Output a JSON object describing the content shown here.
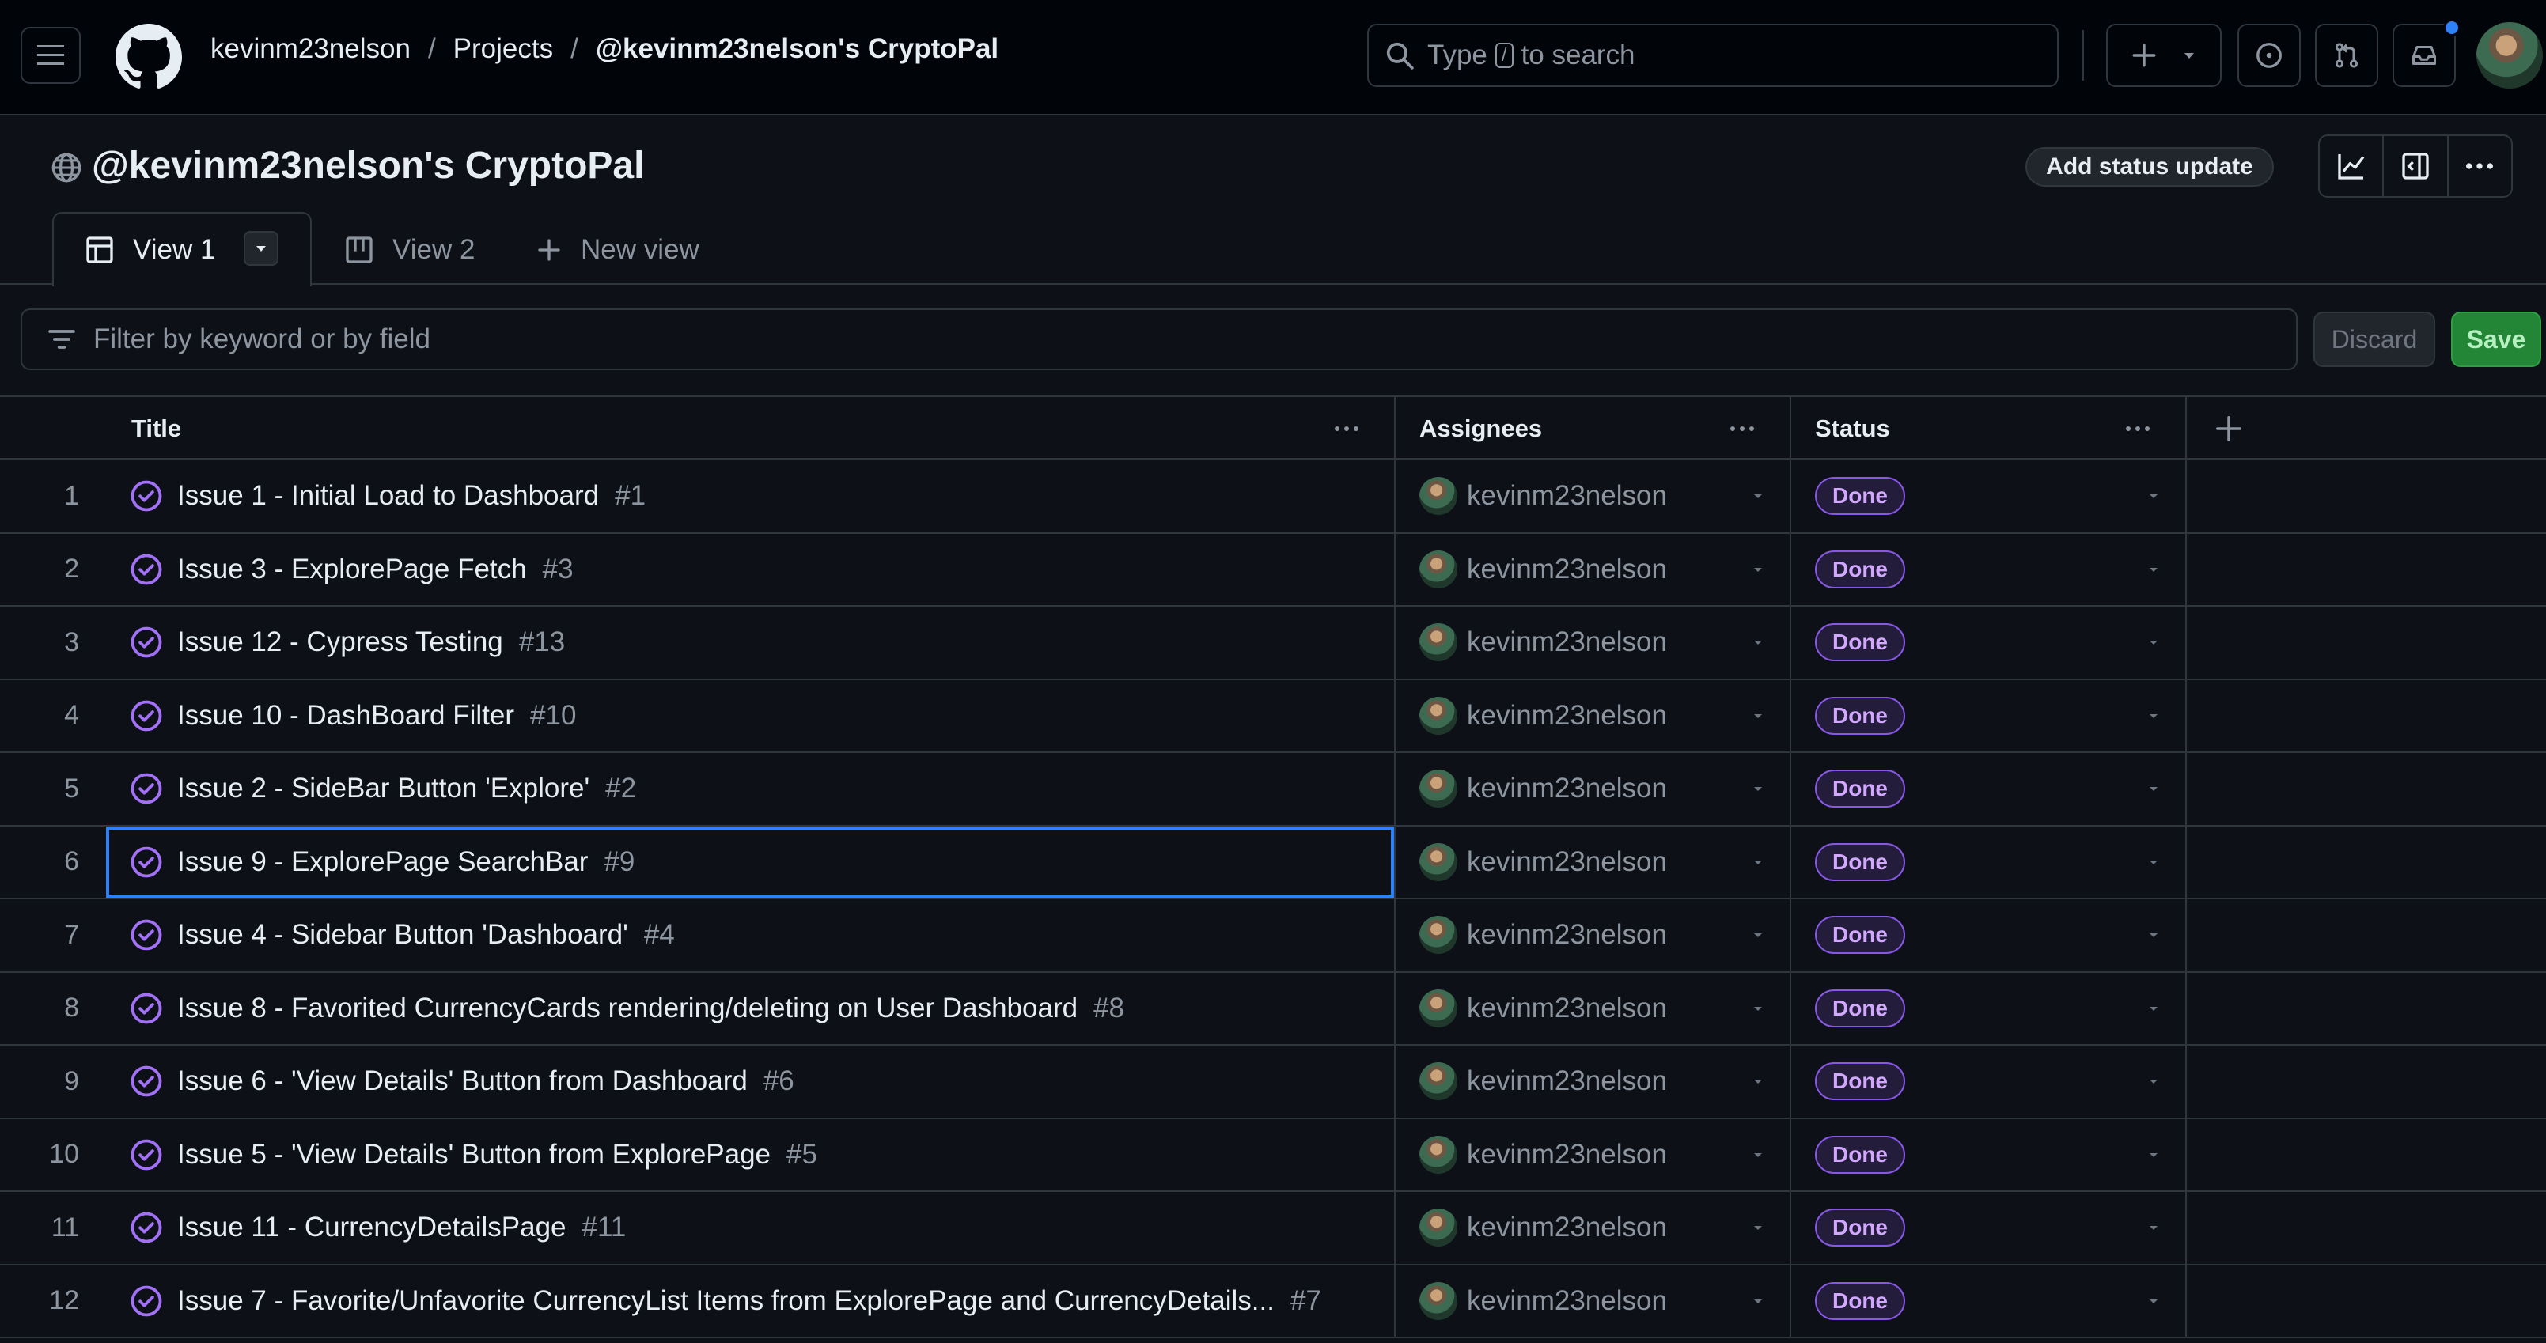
{
  "header": {
    "breadcrumbs": [
      "kevinm23nelson",
      "Projects",
      "@kevinm23nelson's CryptoPal"
    ],
    "separator": "/",
    "search": {
      "prefix": "Type",
      "key": "/",
      "suffix": "to search"
    }
  },
  "project": {
    "title": "@kevinm23nelson's CryptoPal",
    "status_update_label": "Add status update"
  },
  "tabs": [
    {
      "label": "View 1",
      "active": true
    },
    {
      "label": "View 2",
      "active": false
    }
  ],
  "new_view_label": "New view",
  "filter": {
    "placeholder": "Filter by keyword or by field",
    "discard_label": "Discard",
    "save_label": "Save"
  },
  "table": {
    "columns": [
      "Title",
      "Assignees",
      "Status"
    ],
    "rows": [
      {
        "index": "1",
        "title": "Issue 1 - Initial Load to Dashboard",
        "number": "#1",
        "assignee": "kevinm23nelson",
        "status": "Done"
      },
      {
        "index": "2",
        "title": "Issue 3 - ExplorePage Fetch",
        "number": "#3",
        "assignee": "kevinm23nelson",
        "status": "Done"
      },
      {
        "index": "3",
        "title": "Issue 12 - Cypress Testing",
        "number": "#13",
        "assignee": "kevinm23nelson",
        "status": "Done"
      },
      {
        "index": "4",
        "title": "Issue 10 - DashBoard Filter",
        "number": "#10",
        "assignee": "kevinm23nelson",
        "status": "Done"
      },
      {
        "index": "5",
        "title": "Issue 2 - SideBar Button 'Explore'",
        "number": "#2",
        "assignee": "kevinm23nelson",
        "status": "Done"
      },
      {
        "index": "6",
        "title": "Issue 9 - ExplorePage SearchBar",
        "number": "#9",
        "assignee": "kevinm23nelson",
        "status": "Done",
        "selected": true
      },
      {
        "index": "7",
        "title": "Issue 4 - Sidebar Button 'Dashboard'",
        "number": "#4",
        "assignee": "kevinm23nelson",
        "status": "Done"
      },
      {
        "index": "8",
        "title": "Issue 8 - Favorited CurrencyCards rendering/deleting on User Dashboard",
        "number": "#8",
        "assignee": "kevinm23nelson",
        "status": "Done"
      },
      {
        "index": "9",
        "title": "Issue 6 - 'View Details' Button from Dashboard",
        "number": "#6",
        "assignee": "kevinm23nelson",
        "status": "Done"
      },
      {
        "index": "10",
        "title": "Issue 5 - 'View Details' Button from ExplorePage",
        "number": "#5",
        "assignee": "kevinm23nelson",
        "status": "Done"
      },
      {
        "index": "11",
        "title": "Issue 11 - CurrencyDetailsPage",
        "number": "#11",
        "assignee": "kevinm23nelson",
        "status": "Done"
      },
      {
        "index": "12",
        "title": "Issue 7 - Favorite/Unfavorite CurrencyList Items from ExplorePage and CurrencyDetails...",
        "number": "#7",
        "assignee": "kevinm23nelson",
        "status": "Done"
      }
    ]
  },
  "colors": {
    "background": "#0d1117",
    "topbar": "#010409",
    "border": "#30363d",
    "done_badge": "#8957e5",
    "save_green": "#238636",
    "selection_blue": "#2f81f7"
  }
}
